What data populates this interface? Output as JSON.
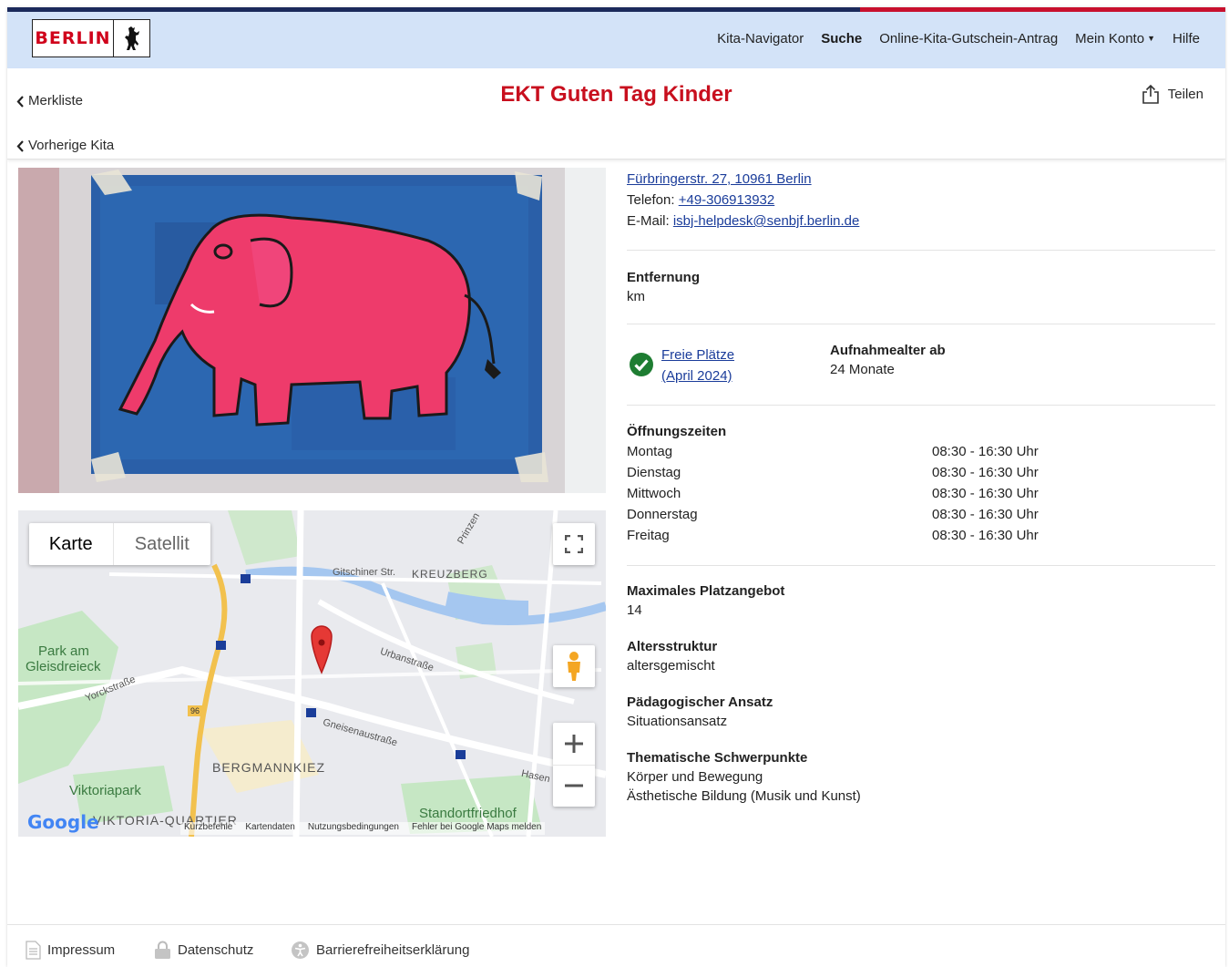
{
  "header": {
    "logo_text": "BERLIN",
    "nav": [
      "Kita-Navigator",
      "Suche",
      "Online-Kita-Gutschein-Antrag",
      "Mein Konto",
      "Hilfe"
    ]
  },
  "titlebar": {
    "back_watchlist": "Merkliste",
    "title": "EKT Guten Tag Kinder",
    "share": "Teilen",
    "prev_kita": "Vorherige Kita"
  },
  "map": {
    "tab_map": "Karte",
    "tab_satellite": "Satellit",
    "labels": {
      "kreuzberg": "KREUZBERG",
      "gitschiner": "Gitschiner Str.",
      "park": "Park am",
      "park2": "Gleisdreieck",
      "yorck": "Yorckstraße",
      "urban": "Urbanstraße",
      "gneisenau": "Gneisenaustraße",
      "bergmannkiez": "BERGMANNKIEZ",
      "viktoriapark": "Viktoriapark",
      "viktoria": "VIKTORIA-QUARTIER",
      "friedhof": "Standortfriedhof",
      "hasen": "Hasen",
      "prinzen": "Prinzen",
      "route": "96"
    },
    "google": "Google",
    "footer": [
      "Kurzbefehle",
      "Kartendaten",
      "Nutzungsbedingungen",
      "Fehler bei Google Maps melden"
    ]
  },
  "details": {
    "address": "Fürbringerstr. 27, 10961 Berlin",
    "phone_label": "Telefon:",
    "phone": "+49-306913932",
    "email_label": "E-Mail:",
    "email": "isbj-helpdesk@senbjf.berlin.de",
    "distance_label": "Entfernung",
    "distance_value": "km",
    "free_places": "Freie Plätze",
    "free_places_date": "(April 2024)",
    "admission_label": "Aufnahmealter ab",
    "admission_value": "24 Monate",
    "hours_label": "Öffnungszeiten",
    "hours": [
      {
        "day": "Montag",
        "time": "08:30 - 16:30 Uhr"
      },
      {
        "day": "Dienstag",
        "time": "08:30 - 16:30 Uhr"
      },
      {
        "day": "Mittwoch",
        "time": "08:30 - 16:30 Uhr"
      },
      {
        "day": "Donnerstag",
        "time": "08:30 - 16:30 Uhr"
      },
      {
        "day": "Freitag",
        "time": "08:30 - 16:30 Uhr"
      }
    ],
    "capacity_label": "Maximales Platzangebot",
    "capacity_value": "14",
    "age_label": "Altersstruktur",
    "age_value": "altersgemischt",
    "pedagogy_label": "Pädagogischer Ansatz",
    "pedagogy_value": "Situationsansatz",
    "focus_label": "Thematische Schwerpunkte",
    "focus_values": [
      "Körper und Bewegung",
      "Ästhetische Bildung (Musik und Kunst)"
    ]
  },
  "footer": {
    "impressum": "Impressum",
    "datenschutz": "Datenschutz",
    "barriere": "Barrierefreiheitserklärung"
  },
  "colors": {
    "header_bg": "#d3e3f8",
    "title_red": "#c80f1e",
    "link_blue": "#1a3c9a",
    "check_green": "#1e7d32"
  }
}
